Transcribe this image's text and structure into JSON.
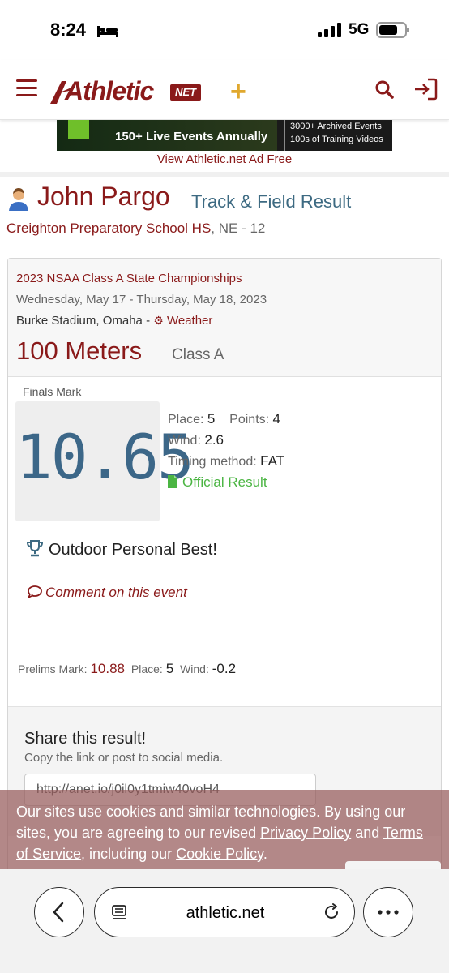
{
  "status_bar": {
    "time": "8:24",
    "network": "5G",
    "icons": [
      "bed-icon",
      "signal-icon",
      "battery-icon"
    ]
  },
  "header": {
    "logo_text": "Athletic",
    "logo_badge": "NET",
    "logo_plus": "+",
    "icons": [
      "menu-icon",
      "search-icon",
      "login-icon"
    ],
    "brand_color": "#8a1a1a"
  },
  "ad": {
    "left_text": "150+ Live Events Annually",
    "right_lines": [
      "3000+ Archived Events",
      "100s of Training Videos"
    ],
    "ad_free_link": "View Athletic.net Ad Free"
  },
  "athlete": {
    "name": "John Pargo",
    "result_type": "Track & Field Result",
    "school": "Creighton Preparatory School HS",
    "school_suffix": ", NE - 12"
  },
  "meet": {
    "name": "2023 NSAA Class A State Championships",
    "dates": "Wednesday, May 17 - Thursday, May 18, 2023",
    "venue": "Burke Stadium, Omaha - ",
    "weather_label": "Weather"
  },
  "event": {
    "name": "100 Meters",
    "class": "Class A"
  },
  "finals": {
    "label": "Finals Mark",
    "mark": "10.65",
    "place_label": "Place:",
    "place": "5",
    "points_label": "Points:",
    "points": "4",
    "wind_label": "Wind:",
    "wind": "2.6",
    "timing_label": "Timing method:",
    "timing": "FAT",
    "official_label": "Official Result"
  },
  "personal_best": "Outdoor Personal Best!",
  "comment_link": "Comment on this event",
  "prelims": {
    "mark_label": "Prelims Mark:",
    "mark": "10.88",
    "place_label": "Place:",
    "place": "5",
    "wind_label": "Wind:",
    "wind": "-0.2"
  },
  "share": {
    "title": "Share this result!",
    "subtitle": "Copy the link or post to social media.",
    "link": "http://anet.io/j0il0y1tmiw40voH4"
  },
  "cookie": {
    "text1": "Our sites use cookies and similar technologies. By using our sites, you are agreeing to our revised ",
    "privacy": "Privacy Policy",
    "text2": " and ",
    "terms": "Terms of Service",
    "text3": ", including our ",
    "cookie_policy": "Cookie Policy",
    "text4": "."
  },
  "browser": {
    "url": "athletic.net"
  }
}
